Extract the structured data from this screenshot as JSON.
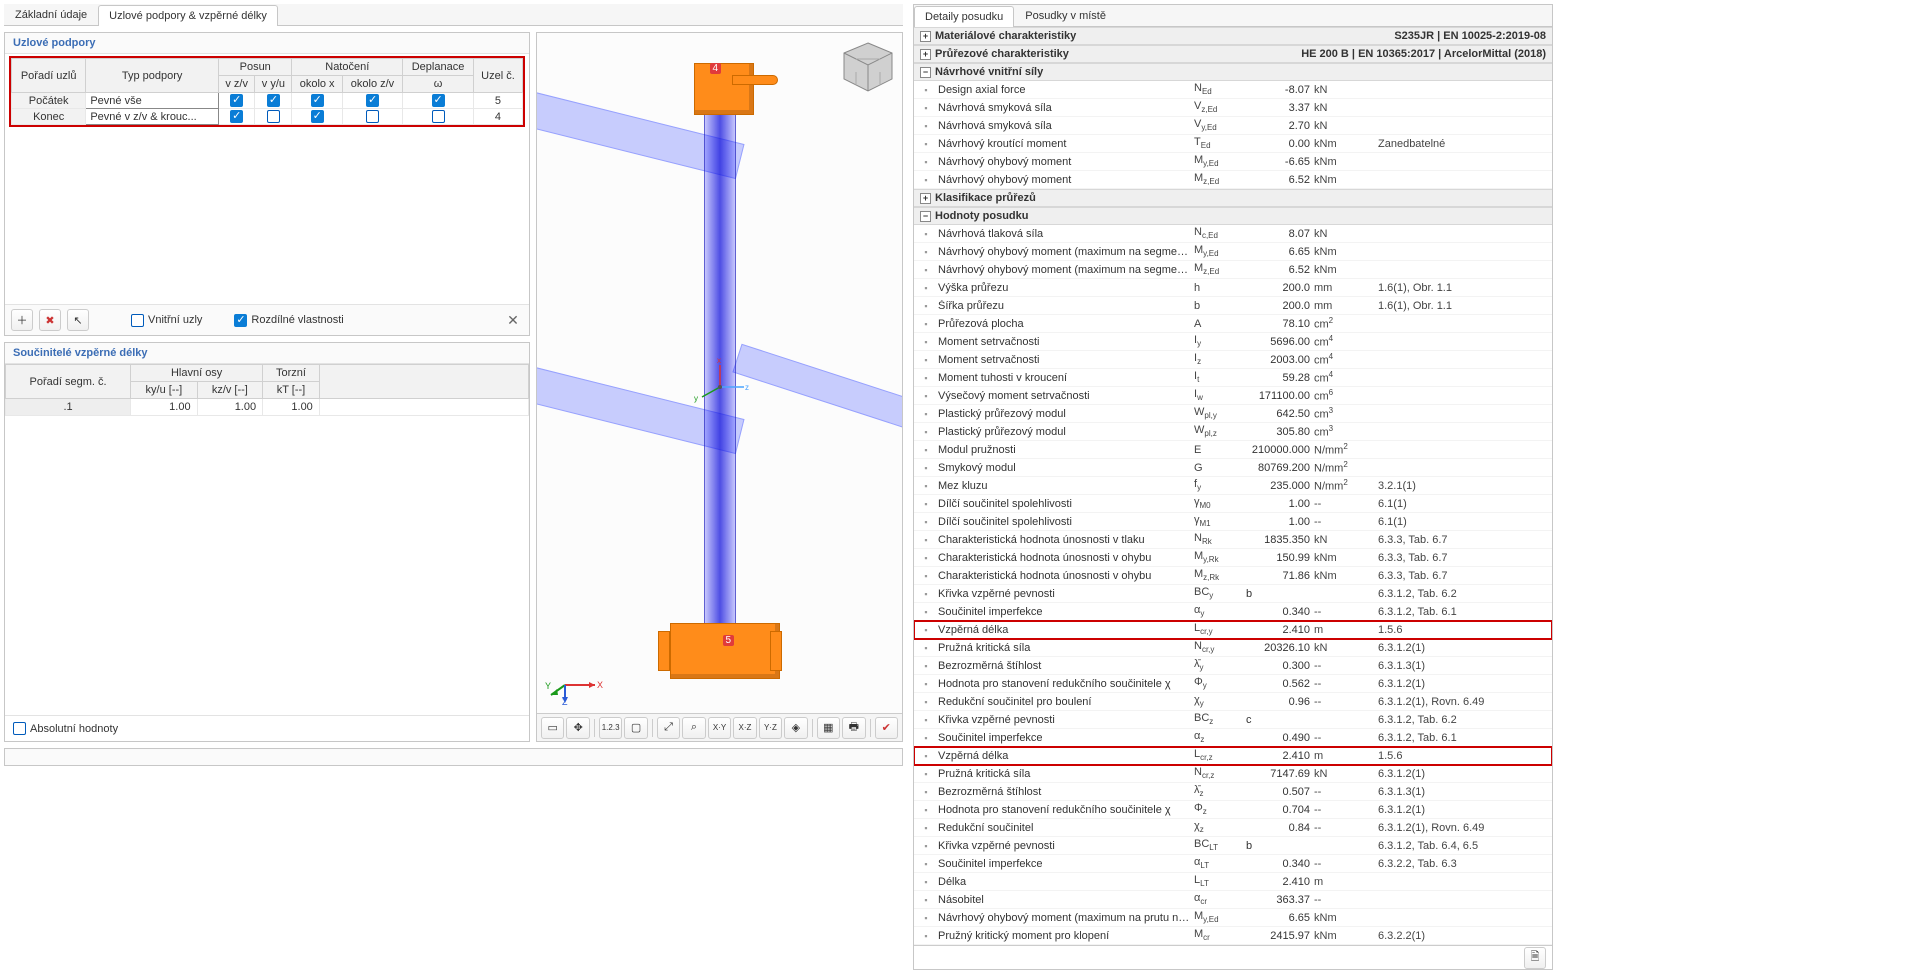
{
  "left_tabs": {
    "t1": "Základní údaje",
    "t2": "Uzlové podpory & vzpěrné délky"
  },
  "supports": {
    "title": "Uzlové podpory",
    "head": {
      "order": "Pořadí uzlů",
      "type": "Typ podpory",
      "posun": "Posun",
      "natoceni": "Natočení",
      "deplanace": "Deplanace",
      "uzel": "Uzel č.",
      "vzv": "v z/v",
      "vyu": "v y/u",
      "ox": "okolo x",
      "ozv": "okolo z/v",
      "omega": "ω"
    },
    "rows": [
      {
        "order": "Počátek",
        "type": "Pevné vše",
        "c1": true,
        "c2": true,
        "c3": true,
        "c4": true,
        "c5": true,
        "node": "5"
      },
      {
        "order": "Konec",
        "type": "Pevné v z/v & krouc...",
        "c1": true,
        "c2": false,
        "c3": true,
        "c4": false,
        "c5": false,
        "node": "4"
      }
    ],
    "chk_inner": "Vnitřní uzly",
    "chk_diff": "Rozdílné vlastnosti"
  },
  "coeff": {
    "title": "Součinitelé vzpěrné délky",
    "head": {
      "seg": "Pořadí segm. č.",
      "main": "Hlavní osy",
      "tors": "Torzní",
      "ky": "ky/u [--]",
      "kz": "kz/v [--]",
      "kt": "kT [--]"
    },
    "rows": [
      {
        "seg": ".1",
        "ky": "1.00",
        "kz": "1.00",
        "kt": "1.00"
      }
    ],
    "abs": "Absolutní hodnoty"
  },
  "right_tabs": {
    "t1": "Detaily posudku",
    "t2": "Posudky v místě"
  },
  "meta": "S235JR | EN 10025-2:2019-08",
  "meta2": "HE 200 B | EN 10365:2017 | ArcelorMittal (2018)",
  "groups": {
    "g1": "Materiálové charakteristiky",
    "g2": "Průřezové charakteristiky",
    "g3": "Návrhové vnitřní síly",
    "g4": "Klasifikace průřezů",
    "g5": "Hodnoty posudku"
  },
  "rows_g3": [
    {
      "l": "Design axial force",
      "s": "N<sub>Ed</sub>",
      "v": "-8.07",
      "u": "kN",
      "r": ""
    },
    {
      "l": "Návrhová smyková síla",
      "s": "V<sub>z,Ed</sub>",
      "v": "3.37",
      "u": "kN",
      "r": ""
    },
    {
      "l": "Návrhová smyková síla",
      "s": "V<sub>y,Ed</sub>",
      "v": "2.70",
      "u": "kN",
      "r": ""
    },
    {
      "l": "Návrhový kroutící moment",
      "s": "T<sub>Ed</sub>",
      "v": "0.00",
      "u": "kNm",
      "r": "Zanedbatelné"
    },
    {
      "l": "Návrhový ohybový moment",
      "s": "M<sub>y,Ed</sub>",
      "v": "-6.65",
      "u": "kNm",
      "r": ""
    },
    {
      "l": "Návrhový ohybový moment",
      "s": "M<sub>z,Ed</sub>",
      "v": "6.52",
      "u": "kNm",
      "r": ""
    }
  ],
  "rows_g5": [
    {
      "l": "Návrhová tlaková síla",
      "s": "N<sub>c,Ed</sub>",
      "v": "8.07",
      "u": "kN",
      "r": ""
    },
    {
      "l": "Návrhový ohybový moment (maximum na segmentu)",
      "s": "M<sub>y,Ed</sub>",
      "v": "6.65",
      "u": "kNm",
      "r": ""
    },
    {
      "l": "Návrhový ohybový moment (maximum na segmentu)",
      "s": "M<sub>z,Ed</sub>",
      "v": "6.52",
      "u": "kNm",
      "r": ""
    },
    {
      "l": "Výška průřezu",
      "s": "h",
      "v": "200.0",
      "u": "mm",
      "r": "1.6(1), Obr. 1.1"
    },
    {
      "l": "Šířka průřezu",
      "s": "b",
      "v": "200.0",
      "u": "mm",
      "r": "1.6(1), Obr. 1.1"
    },
    {
      "l": "Průřezová plocha",
      "s": "A",
      "v": "78.10",
      "u": "cm<sup>2</sup>",
      "r": ""
    },
    {
      "l": "Moment setrvačnosti",
      "s": "I<sub>y</sub>",
      "v": "5696.00",
      "u": "cm<sup>4</sup>",
      "r": ""
    },
    {
      "l": "Moment setrvačnosti",
      "s": "I<sub>z</sub>",
      "v": "2003.00",
      "u": "cm<sup>4</sup>",
      "r": ""
    },
    {
      "l": "Moment tuhosti v kroucení",
      "s": "I<sub>t</sub>",
      "v": "59.28",
      "u": "cm<sup>4</sup>",
      "r": ""
    },
    {
      "l": "Výsečový moment setrvačnosti",
      "s": "I<sub>w</sub>",
      "v": "171100.00",
      "u": "cm<sup>6</sup>",
      "r": ""
    },
    {
      "l": "Plastický průřezový modul",
      "s": "W<sub>pl,y</sub>",
      "v": "642.50",
      "u": "cm<sup>3</sup>",
      "r": ""
    },
    {
      "l": "Plastický průřezový modul",
      "s": "W<sub>pl,z</sub>",
      "v": "305.80",
      "u": "cm<sup>3</sup>",
      "r": ""
    },
    {
      "l": "Modul pružnosti",
      "s": "E",
      "v": "210000.000",
      "u": "N/mm<sup>2</sup>",
      "r": ""
    },
    {
      "l": "Smykový modul",
      "s": "G",
      "v": "80769.200",
      "u": "N/mm<sup>2</sup>",
      "r": ""
    },
    {
      "l": "Mez kluzu",
      "s": "f<sub>y</sub>",
      "v": "235.000",
      "u": "N/mm<sup>2</sup>",
      "r": "3.2.1(1)"
    },
    {
      "l": "Dílčí součinitel spolehlivosti",
      "s": "γ<sub>M0</sub>",
      "v": "1.00",
      "u": "--",
      "r": "6.1(1)"
    },
    {
      "l": "Dílčí součinitel spolehlivosti",
      "s": "γ<sub>M1</sub>",
      "v": "1.00",
      "u": "--",
      "r": "6.1(1)"
    },
    {
      "l": "Charakteristická hodnota únosnosti v tlaku",
      "s": "N<sub>Rk</sub>",
      "v": "1835.350",
      "u": "kN",
      "r": "6.3.3, Tab. 6.7"
    },
    {
      "l": "Charakteristická hodnota únosnosti v ohybu",
      "s": "M<sub>y,Rk</sub>",
      "v": "150.99",
      "u": "kNm",
      "r": "6.3.3, Tab. 6.7"
    },
    {
      "l": "Charakteristická hodnota únosnosti v ohybu",
      "s": "M<sub>z,Rk</sub>",
      "v": "71.86",
      "u": "kNm",
      "r": "6.3.3, Tab. 6.7"
    },
    {
      "l": "Křivka vzpěrné pevnosti",
      "s": "BC<sub>y</sub>",
      "v": "b",
      "u": "",
      "r": "6.3.1.2, Tab. 6.2",
      "textval": true
    },
    {
      "l": "Součinitel imperfekce",
      "s": "α<sub>y</sub>",
      "v": "0.340",
      "u": "--",
      "r": "6.3.1.2, Tab. 6.1"
    },
    {
      "l": "Vzpěrná délka",
      "s": "L<sub>cr,y</sub>",
      "v": "2.410",
      "u": "m",
      "r": "1.5.6",
      "hl": true
    },
    {
      "l": "Pružná kritická síla",
      "s": "N<sub>cr,y</sub>",
      "v": "20326.10",
      "u": "kN",
      "r": "6.3.1.2(1)"
    },
    {
      "l": "Bezrozměrná štíhlost",
      "s": "λ̄<sub>y</sub>",
      "v": "0.300",
      "u": "--",
      "r": "6.3.1.3(1)"
    },
    {
      "l": "Hodnota pro stanovení redukčního součinitele χ",
      "s": "Φ<sub>y</sub>",
      "v": "0.562",
      "u": "--",
      "r": "6.3.1.2(1)"
    },
    {
      "l": "Redukční součinitel pro boulení",
      "s": "χ<sub>y</sub>",
      "v": "0.96",
      "u": "--",
      "r": "6.3.1.2(1), Rovn. 6.49"
    },
    {
      "l": "Křivka vzpěrné pevnosti",
      "s": "BC<sub>z</sub>",
      "v": "c",
      "u": "",
      "r": "6.3.1.2, Tab. 6.2",
      "textval": true
    },
    {
      "l": "Součinitel imperfekce",
      "s": "α<sub>z</sub>",
      "v": "0.490",
      "u": "--",
      "r": "6.3.1.2, Tab. 6.1"
    },
    {
      "l": "Vzpěrná délka",
      "s": "L<sub>cr,z</sub>",
      "v": "2.410",
      "u": "m",
      "r": "1.5.6",
      "hl": true
    },
    {
      "l": "Pružná kritická síla",
      "s": "N<sub>cr,z</sub>",
      "v": "7147.69",
      "u": "kN",
      "r": "6.3.1.2(1)"
    },
    {
      "l": "Bezrozměrná štíhlost",
      "s": "λ̄<sub>z</sub>",
      "v": "0.507",
      "u": "--",
      "r": "6.3.1.3(1)"
    },
    {
      "l": "Hodnota pro stanovení redukčního součinitele χ",
      "s": "Φ<sub>z</sub>",
      "v": "0.704",
      "u": "--",
      "r": "6.3.1.2(1)"
    },
    {
      "l": "Redukční součinitel",
      "s": "χ<sub>z</sub>",
      "v": "0.84",
      "u": "--",
      "r": "6.3.1.2(1), Rovn. 6.49"
    },
    {
      "l": "Křivka vzpěrné pevnosti",
      "s": "BC<sub>LT</sub>",
      "v": "b",
      "u": "",
      "r": "6.3.1.2, Tab. 6.4, 6.5",
      "textval": true
    },
    {
      "l": "Součinitel imperfekce",
      "s": "α<sub>LT</sub>",
      "v": "0.340",
      "u": "--",
      "r": "6.3.2.2, Tab. 6.3"
    },
    {
      "l": "Délka",
      "s": "L<sub>LT</sub>",
      "v": "2.410",
      "u": "m",
      "r": ""
    },
    {
      "l": "Násobitel",
      "s": "α<sub>cr</sub>",
      "v": "363.37",
      "u": "--",
      "r": ""
    },
    {
      "l": "Návrhový ohybový moment (maximum na prutu nebo s...",
      "s": "M<sub>y,Ed</sub>",
      "v": "6.65",
      "u": "kNm",
      "r": ""
    },
    {
      "l": "Pružný kritický moment pro klopení",
      "s": "M<sub>cr</sub>",
      "v": "2415.97",
      "u": "kNm",
      "r": "6.3.2.2(1)"
    }
  ]
}
